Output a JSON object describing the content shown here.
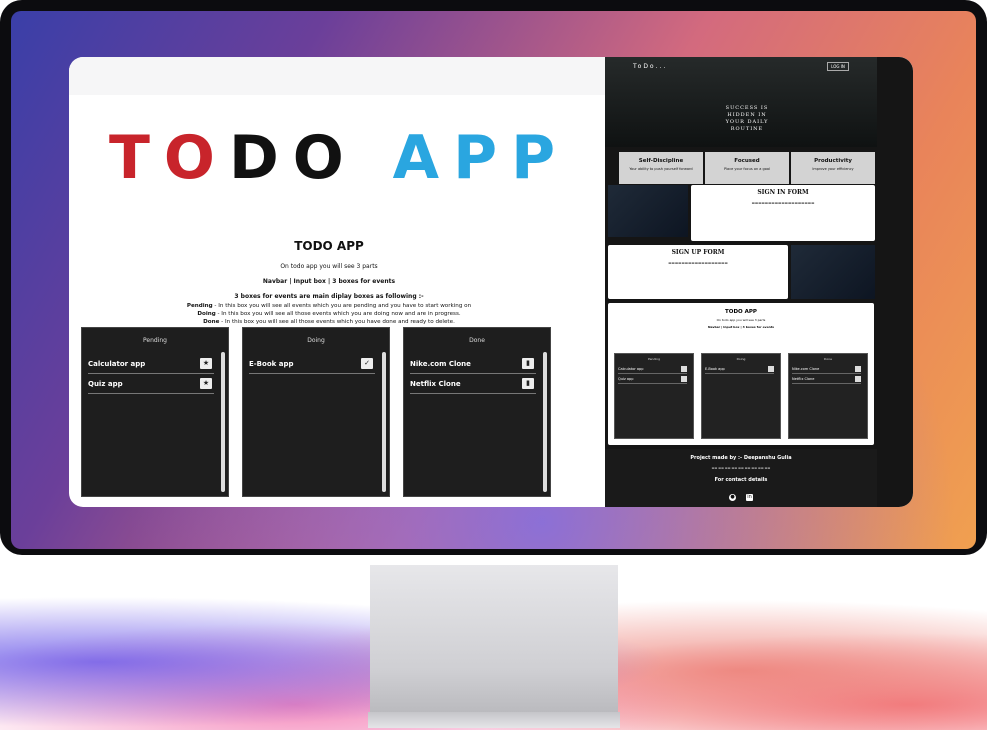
{
  "hero": {
    "w1": "TO",
    "w2": "D",
    "w3": "O",
    "w4": "APP"
  },
  "info": {
    "title": "TODO APP",
    "subtitle": "On todo app you will see 3 parts",
    "parts": "Navbar | Input box | 3 boxes for events",
    "boxes_title": "3 boxes for events are main diplay boxes as following :-",
    "pending_label": "Pending",
    "pending_text": " - In this box you will see all events which you are pending and you have to start working on",
    "doing_label": "Doing",
    "doing_text": " - In this box you will see all those events which you are doing now and are in progress.",
    "done_label": "Done",
    "done_text": " - In this box you will see all those events which you have done and ready to delete."
  },
  "boards": {
    "pending": {
      "title": "Pending",
      "items": [
        "Calculator app",
        "Quiz app"
      ]
    },
    "doing": {
      "title": "Doing",
      "items": [
        "E-Book app"
      ]
    },
    "done": {
      "title": "Done",
      "items": [
        "Nike.com Clone",
        "Netflix Clone"
      ]
    }
  },
  "preview": {
    "logo": "ToDo...",
    "login": "LOG IN",
    "tagline": "SUCCESS IS HIDDEN IN YOUR DAILY ROUTINE",
    "features": [
      {
        "title": "Self-Discipline",
        "desc": "Your ability to push yourself forward"
      },
      {
        "title": "Focused",
        "desc": "Place your focus on a goal"
      },
      {
        "title": "Productivity",
        "desc": "Improve your efficiency"
      }
    ],
    "signin_title": "SIGN IN FORM",
    "signup_title": "SIGN UP FORM",
    "mini_title": "TODO APP",
    "mini_sub": "On todo app you will see 3 parts",
    "mini_parts": "Navbar | Input box | 3 boxes for events",
    "mini_boards": [
      {
        "title": "Pending",
        "items": [
          "Calculator app",
          "Quiz app"
        ]
      },
      {
        "title": "Doing",
        "items": [
          "E-Book app"
        ]
      },
      {
        "title": "Done",
        "items": [
          "Nike.com Clone",
          "Netflix Clone"
        ]
      }
    ],
    "author": "Project made by :- Deepanshu Gulia",
    "contact": "For contact details"
  },
  "colors": {
    "red": "#c8242b",
    "black": "#111111",
    "blue": "#2aa6e0"
  },
  "icons": {
    "pending_btn": "star-icon",
    "doing_btn": "check-icon",
    "done_btn": "trash-icon"
  }
}
